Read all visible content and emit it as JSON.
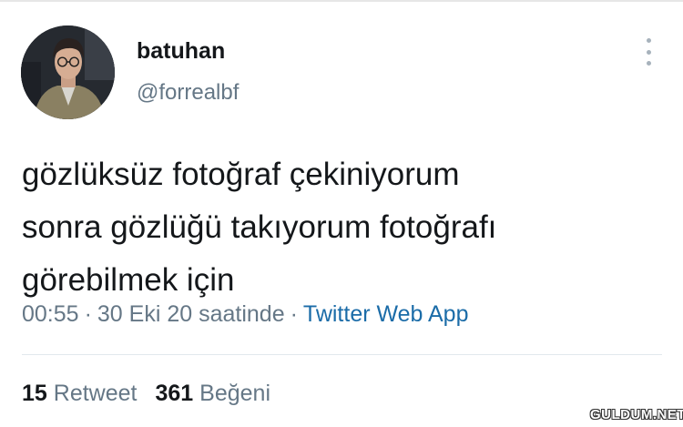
{
  "tweet": {
    "author": {
      "display_name": "batuhan",
      "handle": "@forrealbf"
    },
    "text_lines": [
      "gözlüksüz fotoğraf çekiniyorum",
      "sonra gözlüğü takıyorum fotoğrafı",
      "görebilmek için"
    ],
    "time": "00:55",
    "date": "30 Eki 20 saatinde",
    "separator": "·",
    "source": "Twitter Web App"
  },
  "stats": {
    "retweets_count": "15",
    "retweets_label": "Retweet",
    "likes_count": "361",
    "likes_label": "Beğeni"
  },
  "icons": {
    "more": "more-vertical-icon",
    "avatar": "profile-photo"
  },
  "watermark": "GULDUM.NET",
  "colors": {
    "text_primary": "#14171a",
    "text_secondary": "#657786",
    "source_link": "#1b6ca8",
    "divider": "#e1e8ed"
  }
}
